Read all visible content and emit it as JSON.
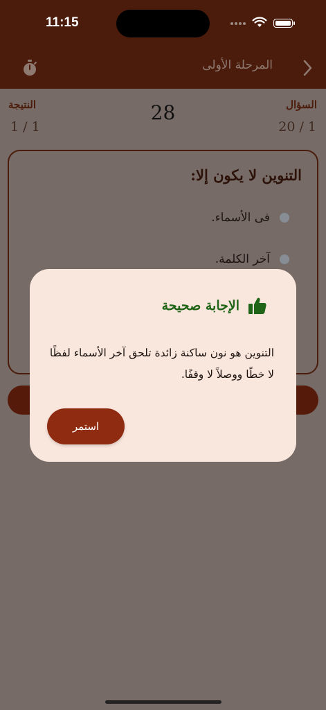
{
  "status_bar": {
    "time": "11:15"
  },
  "nav": {
    "title": "المرحلة الأولى"
  },
  "stats": {
    "score_label": "النتيجة",
    "score_value": "1 / 1",
    "timer": "28",
    "question_label": "السؤال",
    "question_value": "20 / 1"
  },
  "question": {
    "text": "التنوين لا يكون إلا:",
    "options": [
      {
        "label": "فى الأسماء."
      },
      {
        "label": "آخر الكلمة."
      }
    ]
  },
  "dialog": {
    "title": "الإجابة صحيحة",
    "message": "التنوين هو نون ساكنة زائدة تلحق آخر الأسماء لفظًا لا خطًا ووصلاً لا وقفًا.",
    "continue_label": "استمر"
  },
  "colors": {
    "header": "#4b1c0b",
    "accent": "#8f2b11",
    "success": "#1f6417",
    "dialog_bg": "#f9e6dd"
  }
}
